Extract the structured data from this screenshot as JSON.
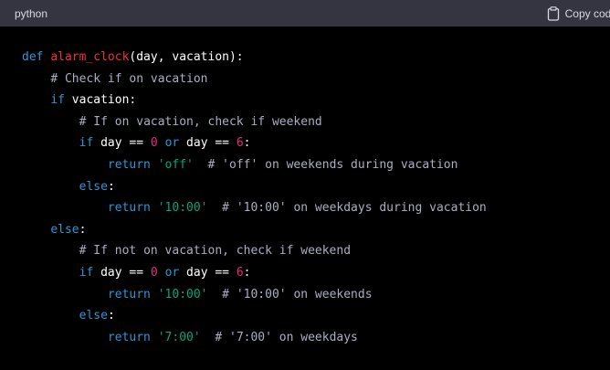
{
  "header": {
    "language": "python",
    "copy_label": "Copy code",
    "copy_icon": "clipboard-icon"
  },
  "colors": {
    "header_bg": "#343541",
    "code_bg": "#000000",
    "keyword": "#2e95d3",
    "function_name": "#f22c3d",
    "comment": "#a9aec1",
    "number": "#df3079",
    "string": "#00a67d",
    "text": "#ffffff"
  },
  "code": {
    "lines": [
      [
        {
          "t": "kw",
          "v": "def "
        },
        {
          "t": "fn",
          "v": "alarm_clock"
        },
        {
          "t": "txt",
          "v": "(day, vacation):"
        }
      ],
      [
        {
          "t": "txt",
          "v": "    "
        },
        {
          "t": "cm",
          "v": "# Check if on vacation"
        }
      ],
      [
        {
          "t": "txt",
          "v": "    "
        },
        {
          "t": "kw",
          "v": "if"
        },
        {
          "t": "txt",
          "v": " vacation:"
        }
      ],
      [
        {
          "t": "txt",
          "v": "        "
        },
        {
          "t": "cm",
          "v": "# If on vacation, check if weekend"
        }
      ],
      [
        {
          "t": "txt",
          "v": "        "
        },
        {
          "t": "kw",
          "v": "if"
        },
        {
          "t": "txt",
          "v": " day == "
        },
        {
          "t": "num",
          "v": "0"
        },
        {
          "t": "txt",
          "v": " "
        },
        {
          "t": "kw",
          "v": "or"
        },
        {
          "t": "txt",
          "v": " day == "
        },
        {
          "t": "num",
          "v": "6"
        },
        {
          "t": "txt",
          "v": ":"
        }
      ],
      [
        {
          "t": "txt",
          "v": "            "
        },
        {
          "t": "kw",
          "v": "return"
        },
        {
          "t": "txt",
          "v": " "
        },
        {
          "t": "str",
          "v": "'off'"
        },
        {
          "t": "txt",
          "v": "  "
        },
        {
          "t": "cm",
          "v": "# 'off' on weekends during vacation"
        }
      ],
      [
        {
          "t": "txt",
          "v": "        "
        },
        {
          "t": "kw",
          "v": "else"
        },
        {
          "t": "txt",
          "v": ":"
        }
      ],
      [
        {
          "t": "txt",
          "v": "            "
        },
        {
          "t": "kw",
          "v": "return"
        },
        {
          "t": "txt",
          "v": " "
        },
        {
          "t": "str",
          "v": "'10:00'"
        },
        {
          "t": "txt",
          "v": "  "
        },
        {
          "t": "cm",
          "v": "# '10:00' on weekdays during vacation"
        }
      ],
      [
        {
          "t": "txt",
          "v": "    "
        },
        {
          "t": "kw",
          "v": "else"
        },
        {
          "t": "txt",
          "v": ":"
        }
      ],
      [
        {
          "t": "txt",
          "v": "        "
        },
        {
          "t": "cm",
          "v": "# If not on vacation, check if weekend"
        }
      ],
      [
        {
          "t": "txt",
          "v": "        "
        },
        {
          "t": "kw",
          "v": "if"
        },
        {
          "t": "txt",
          "v": " day == "
        },
        {
          "t": "num",
          "v": "0"
        },
        {
          "t": "txt",
          "v": " "
        },
        {
          "t": "kw",
          "v": "or"
        },
        {
          "t": "txt",
          "v": " day == "
        },
        {
          "t": "num",
          "v": "6"
        },
        {
          "t": "txt",
          "v": ":"
        }
      ],
      [
        {
          "t": "txt",
          "v": "            "
        },
        {
          "t": "kw",
          "v": "return"
        },
        {
          "t": "txt",
          "v": " "
        },
        {
          "t": "str",
          "v": "'10:00'"
        },
        {
          "t": "txt",
          "v": "  "
        },
        {
          "t": "cm",
          "v": "# '10:00' on weekends"
        }
      ],
      [
        {
          "t": "txt",
          "v": "        "
        },
        {
          "t": "kw",
          "v": "else"
        },
        {
          "t": "txt",
          "v": ":"
        }
      ],
      [
        {
          "t": "txt",
          "v": "            "
        },
        {
          "t": "kw",
          "v": "return"
        },
        {
          "t": "txt",
          "v": " "
        },
        {
          "t": "str",
          "v": "'7:00'"
        },
        {
          "t": "txt",
          "v": "  "
        },
        {
          "t": "cm",
          "v": "# '7:00' on weekdays"
        }
      ]
    ]
  }
}
